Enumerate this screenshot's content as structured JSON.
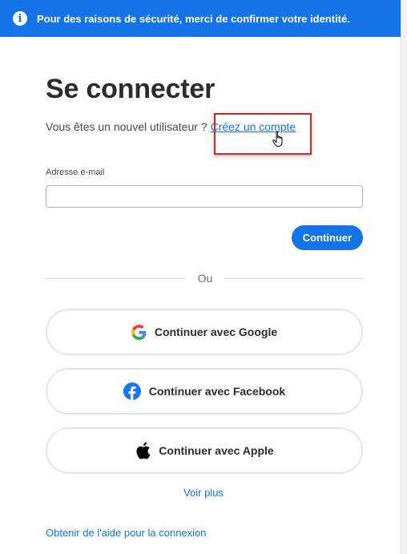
{
  "banner": {
    "icon": "info-icon",
    "message": "Pour des raisons de sécurité, merci de confirmer votre identité."
  },
  "signin": {
    "title": "Se connecter",
    "new_user_prompt": "Vous êtes un nouvel utilisateur ?",
    "create_account_link": "Créez un compte"
  },
  "email": {
    "label": "Adresse e-mail",
    "value": ""
  },
  "continue_label": "Continuer",
  "divider_text": "Ou",
  "social": {
    "google": {
      "label": "Continuer avec Google",
      "icon": "google-icon"
    },
    "facebook": {
      "label": "Continuer avec Facebook",
      "icon": "facebook-icon"
    },
    "apple": {
      "label": "Continuer avec Apple",
      "icon": "apple-icon"
    }
  },
  "see_more": "Voir plus",
  "help_link": "Obtenir de l'aide pour la connexion",
  "colors": {
    "accent": "#1473e6",
    "highlight": "#d9261c"
  }
}
